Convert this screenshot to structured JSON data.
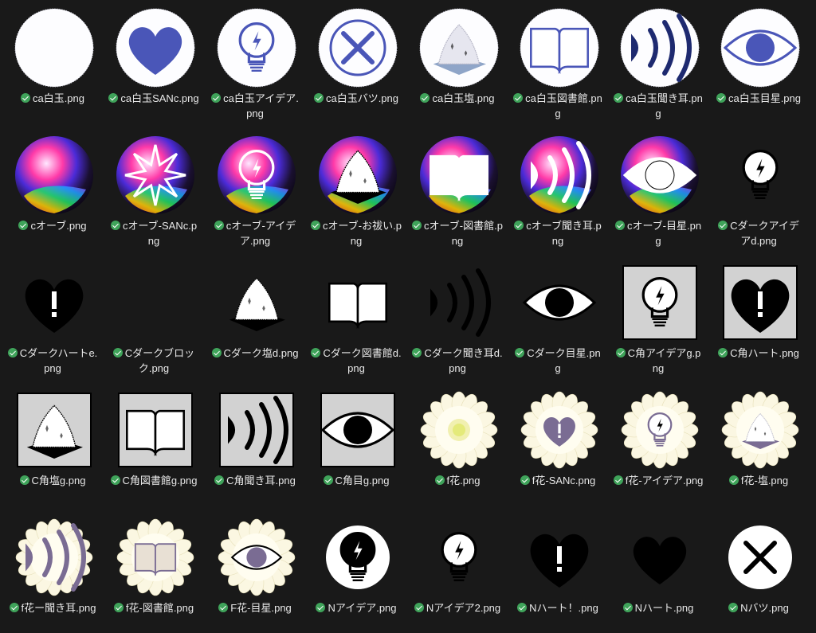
{
  "colors": {
    "background": "#191919",
    "caption_text": "#e8e8e8",
    "status_ok": "#3fa35a",
    "accent_blue": "#4a56b8",
    "flower_purple": "#7a6c93"
  },
  "files": [
    {
      "name": "ca白玉.png",
      "icon": "white-orb",
      "style": "white"
    },
    {
      "name": "ca白玉SANc.png",
      "icon": "heart",
      "style": "white"
    },
    {
      "name": "ca白玉アイデア.png",
      "icon": "bulb",
      "style": "white"
    },
    {
      "name": "ca白玉バツ.png",
      "icon": "x-mark",
      "style": "white"
    },
    {
      "name": "ca白玉塩.png",
      "icon": "salt-pile",
      "style": "white"
    },
    {
      "name": "ca白玉図書館.png",
      "icon": "open-book",
      "style": "white"
    },
    {
      "name": "ca白玉聞き耳.png",
      "icon": "sound-waves",
      "style": "white"
    },
    {
      "name": "ca白玉目星.png",
      "icon": "eye",
      "style": "white"
    },
    {
      "name": "cオーブ.png",
      "icon": "orb",
      "style": "orb"
    },
    {
      "name": "cオーブ-SANc.png",
      "icon": "starburst",
      "style": "orb"
    },
    {
      "name": "cオーブ-アイデア.png",
      "icon": "bulb",
      "style": "orb"
    },
    {
      "name": "cオーブ-お祓い.png",
      "icon": "salt-pile",
      "style": "orb"
    },
    {
      "name": "cオーブ-図書館.png",
      "icon": "open-book",
      "style": "orb"
    },
    {
      "name": "cオーブ聞き耳.png",
      "icon": "sound-waves",
      "style": "orb"
    },
    {
      "name": "cオーブ-目星.png",
      "icon": "eye",
      "style": "orb"
    },
    {
      "name": "Cダークアイデアd.png",
      "icon": "bulb",
      "style": "dark"
    },
    {
      "name": "Cダークハートe.png",
      "icon": "heart-exclaim",
      "style": "dark"
    },
    {
      "name": "Cダークブロック.png",
      "icon": "blank",
      "style": "dark"
    },
    {
      "name": "Cダーク塩d.png",
      "icon": "salt-pile",
      "style": "dark"
    },
    {
      "name": "Cダーク図書館d.png",
      "icon": "open-book",
      "style": "dark"
    },
    {
      "name": "Cダーク聞き耳d.png",
      "icon": "sound-waves",
      "style": "dark"
    },
    {
      "name": "Cダーク目星.png",
      "icon": "eye",
      "style": "dark"
    },
    {
      "name": "C角アイデアg.png",
      "icon": "bulb",
      "style": "square"
    },
    {
      "name": "C角ハート.png",
      "icon": "heart-exclaim",
      "style": "square"
    },
    {
      "name": "C角塩g.png",
      "icon": "salt-pile",
      "style": "square"
    },
    {
      "name": "C角図書館g.png",
      "icon": "open-book",
      "style": "square"
    },
    {
      "name": "C角聞き耳.png",
      "icon": "sound-waves",
      "style": "square"
    },
    {
      "name": "C角目g.png",
      "icon": "eye",
      "style": "square"
    },
    {
      "name": "f花.png",
      "icon": "flower",
      "style": "flower"
    },
    {
      "name": "f花-SANc.png",
      "icon": "heart-exclaim",
      "style": "flower"
    },
    {
      "name": "f花-アイデア.png",
      "icon": "bulb",
      "style": "flower"
    },
    {
      "name": "f花-塩.png",
      "icon": "salt-pile",
      "style": "flower"
    },
    {
      "name": "f花ー聞き耳.png",
      "icon": "sound-waves",
      "style": "flower"
    },
    {
      "name": "f花-図書館.png",
      "icon": "open-book",
      "style": "flower"
    },
    {
      "name": "F花-目星.png",
      "icon": "eye",
      "style": "flower"
    },
    {
      "name": "Nアイデア.png",
      "icon": "bulb",
      "style": "n-white"
    },
    {
      "name": "Nアイデア2.png",
      "icon": "bulb",
      "style": "n-dark"
    },
    {
      "name": "Nハート！.png",
      "icon": "heart-exclaim",
      "style": "n-dark"
    },
    {
      "name": "Nハート.png",
      "icon": "heart",
      "style": "n-dark"
    },
    {
      "name": "Nバツ.png",
      "icon": "x-mark",
      "style": "n-white"
    }
  ]
}
